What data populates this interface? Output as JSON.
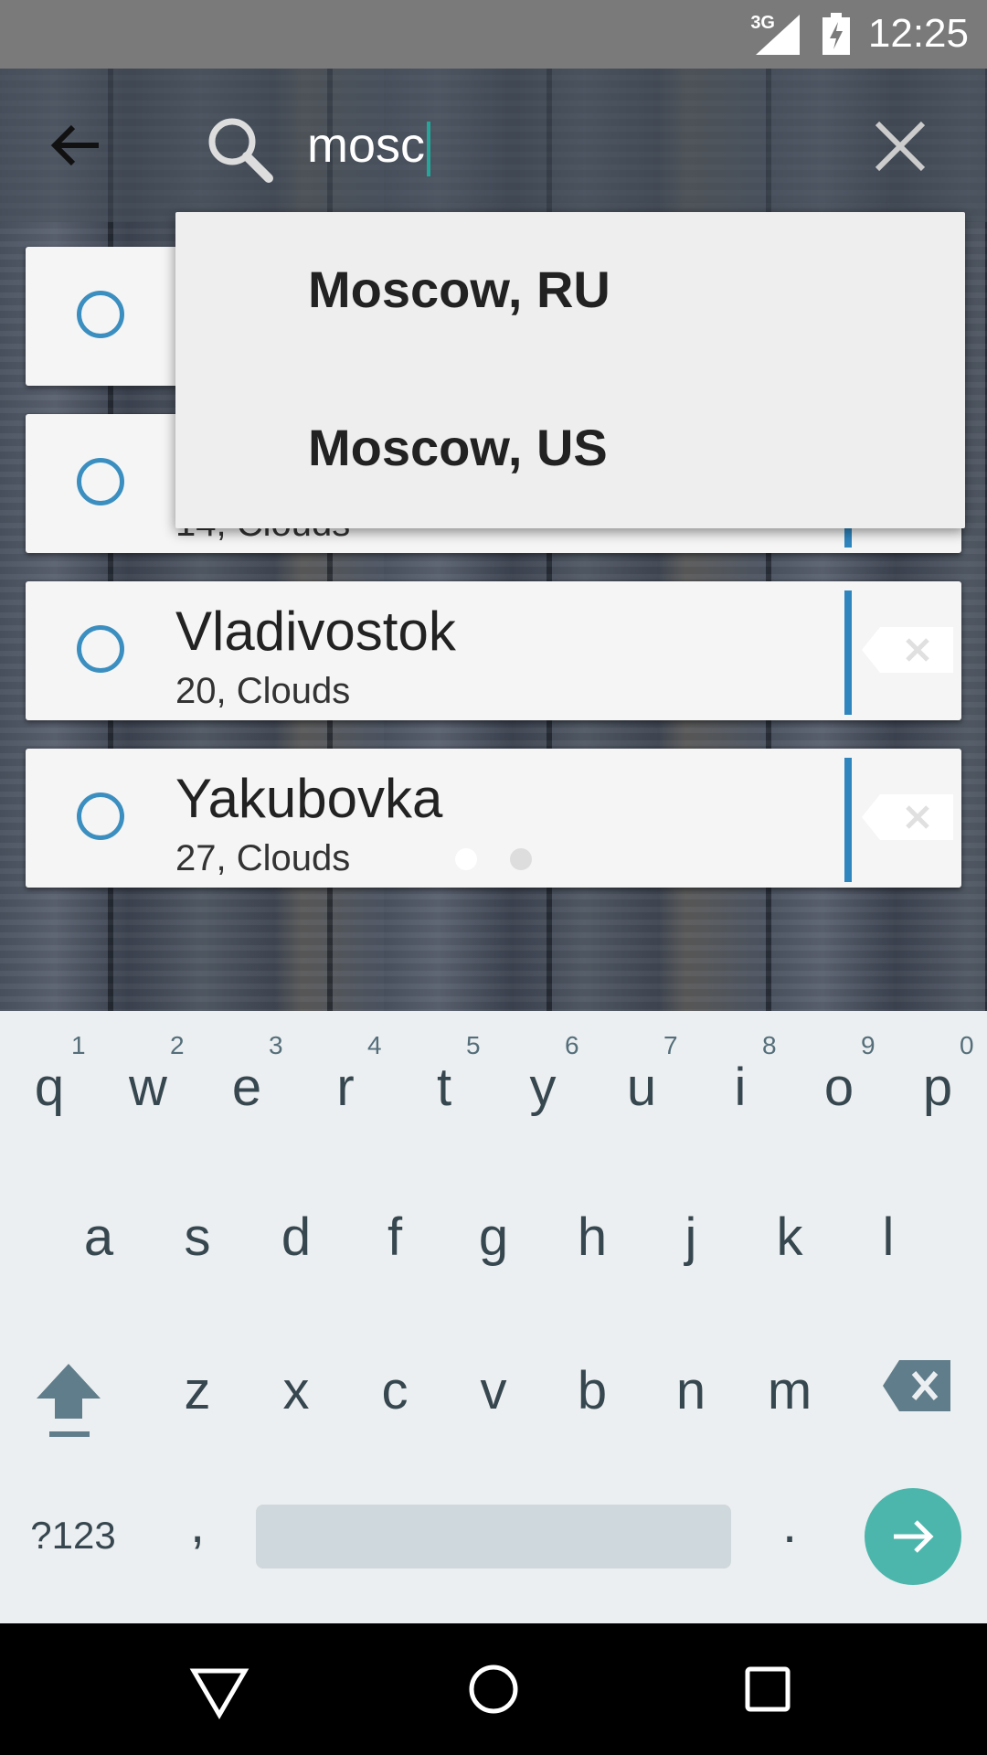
{
  "status_bar": {
    "network": "3G",
    "time": "12:25"
  },
  "search": {
    "query": "mosc"
  },
  "cities": [
    {
      "name": "",
      "subtitle": ""
    },
    {
      "name": "",
      "subtitle": "14, Clouds"
    },
    {
      "name": "Vladivostok",
      "subtitle": "20, Clouds"
    },
    {
      "name": "Yakubovka",
      "subtitle": "27, Clouds"
    }
  ],
  "suggestions": [
    "Moscow, RU",
    "Moscow, US"
  ],
  "keyboard": {
    "row1": [
      "q",
      "w",
      "e",
      "r",
      "t",
      "y",
      "u",
      "i",
      "o",
      "p"
    ],
    "row1_hints": [
      "1",
      "2",
      "3",
      "4",
      "5",
      "6",
      "7",
      "8",
      "9",
      "0"
    ],
    "row2": [
      "a",
      "s",
      "d",
      "f",
      "g",
      "h",
      "j",
      "k",
      "l"
    ],
    "row3": [
      "z",
      "x",
      "c",
      "v",
      "b",
      "n",
      "m"
    ],
    "symbols_label": "?123",
    "comma": ",",
    "period": "."
  },
  "colors": {
    "accent": "#3b8fc0",
    "enter": "#4db6ac",
    "cursor": "#26a69a"
  }
}
